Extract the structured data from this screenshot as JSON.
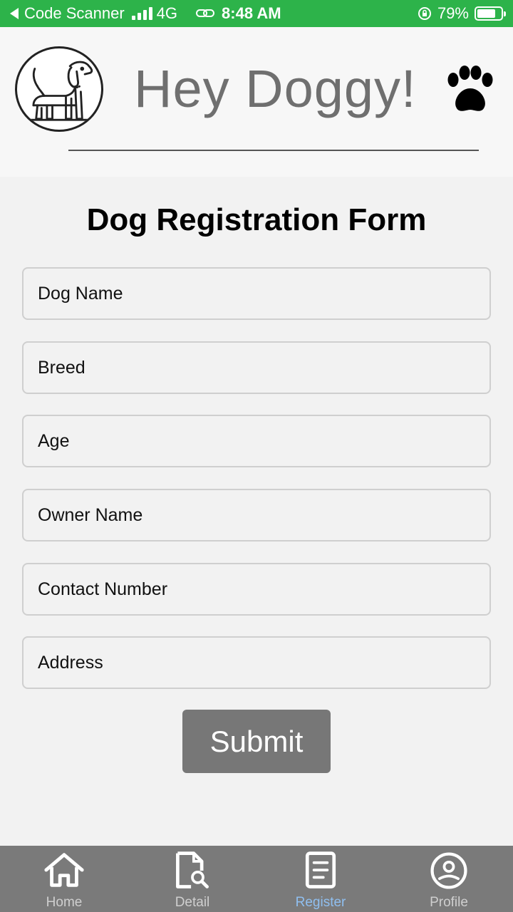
{
  "status_bar": {
    "back_app": "Code Scanner",
    "network": "4G",
    "time": "8:48 AM",
    "battery_percent": "79%",
    "battery_level": 0.79
  },
  "header": {
    "title": "Hey Doggy!"
  },
  "form": {
    "title": "Dog Registration Form",
    "fields": [
      {
        "placeholder": "Dog Name",
        "value": ""
      },
      {
        "placeholder": "Breed",
        "value": ""
      },
      {
        "placeholder": "Age",
        "value": ""
      },
      {
        "placeholder": "Owner Name",
        "value": ""
      },
      {
        "placeholder": "Contact Number",
        "value": ""
      },
      {
        "placeholder": "Address",
        "value": ""
      }
    ],
    "submit_label": "Submit"
  },
  "bottom_nav": {
    "tabs": [
      {
        "label": "Home",
        "icon": "home-icon",
        "active": false
      },
      {
        "label": "Detail",
        "icon": "document-search-icon",
        "active": false
      },
      {
        "label": "Register",
        "icon": "form-icon",
        "active": true
      },
      {
        "label": "Profile",
        "icon": "profile-icon",
        "active": false
      }
    ]
  },
  "colors": {
    "status_bar": "#2db34a",
    "nav_bg": "#7a7a7a",
    "nav_active": "#8fbff0",
    "button_bg": "#777777"
  }
}
